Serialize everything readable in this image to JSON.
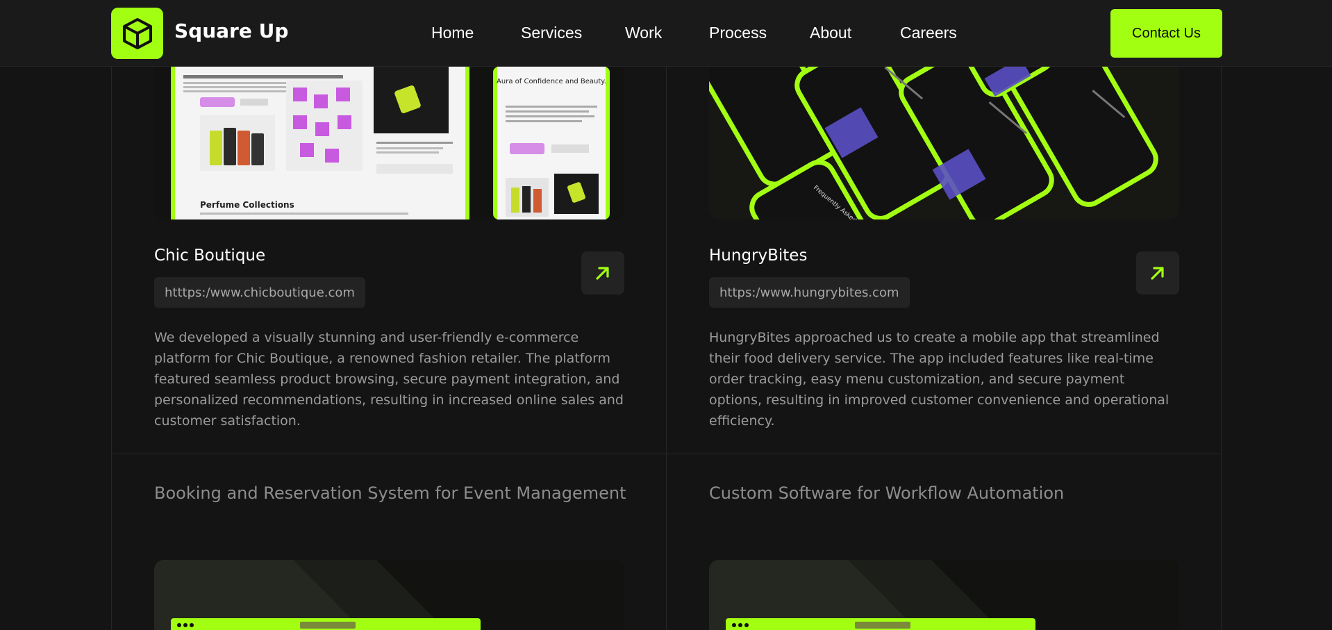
{
  "header": {
    "brand": "Square Up",
    "nav": [
      {
        "label": "Home"
      },
      {
        "label": "Services"
      },
      {
        "label": "Work"
      },
      {
        "label": "Process"
      },
      {
        "label": "About"
      },
      {
        "label": "Careers"
      }
    ],
    "contact_label": "Contact Us"
  },
  "projects": [
    {
      "title": "Chic Boutique",
      "url": "htttps:/www.chicboutique.com",
      "description": "We developed a visually stunning and user-friendly e-commerce platform for Chic Boutique, a renowned fashion retailer. The platform featured seamless product browsing, secure payment integration, and personalized recommendations, resulting in increased online sales and customer satisfaction.",
      "image_heading": "Aura of Confidence and Beauty.",
      "image_section": "Perfume Collections"
    },
    {
      "title": "HungryBites",
      "url": "https:/www.hungrybites.com",
      "description": "HungryBites approached us to create a mobile app that streamlined their food delivery service. The app included features like real-time order tracking, easy menu customization, and secure payment options, resulting in improved customer convenience and operational efficiency.",
      "image_phone_title": "Frequently Asked Questions"
    }
  ],
  "upcoming": [
    {
      "title": "Booking and Reservation System for Event Management"
    },
    {
      "title": "Custom Software for Workflow Automation"
    }
  ],
  "colors": {
    "accent": "#a3ff12",
    "background": "#141414",
    "header": "#1a1a1a",
    "border": "#262626",
    "pill": "#232323"
  },
  "icons": {
    "logo": "cube-icon",
    "card_action": "arrow-up-right-icon"
  }
}
